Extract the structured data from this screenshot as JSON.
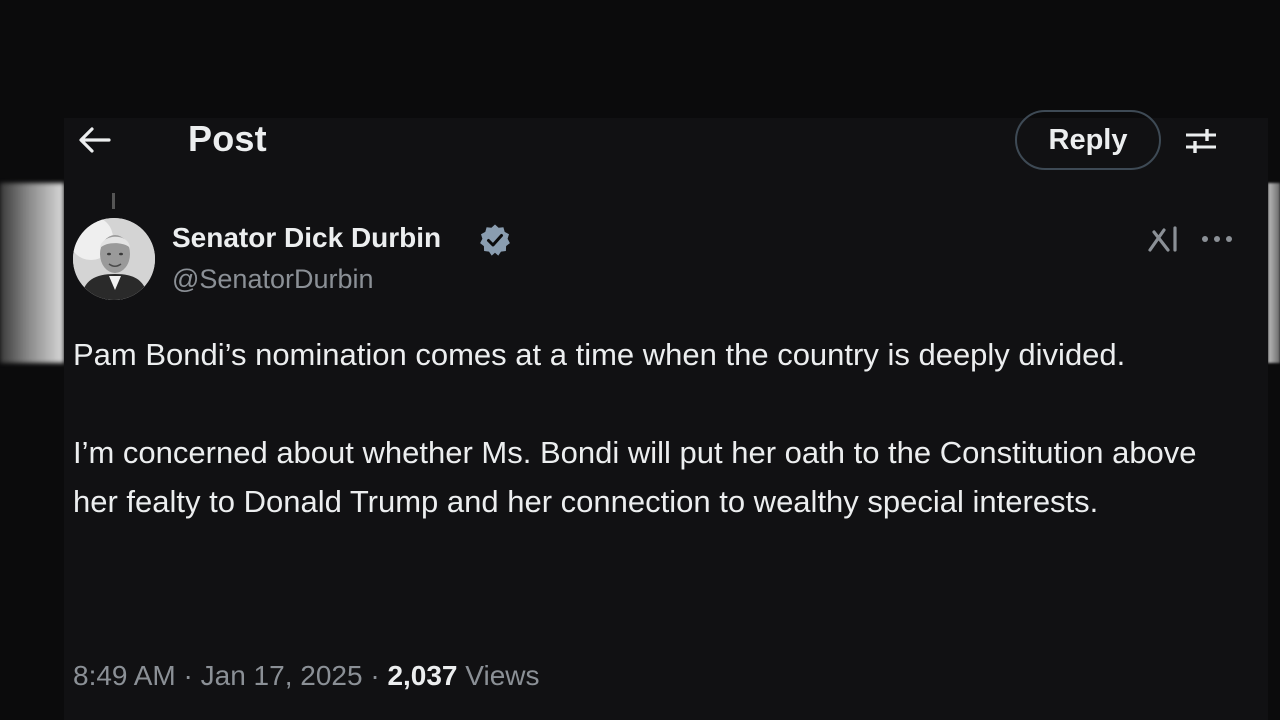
{
  "header": {
    "title": "Post",
    "reply_label": "Reply",
    "back_icon": "arrow-left-icon",
    "filter_icon": "sliders-icon"
  },
  "tweet": {
    "author_name": "Senator Dick Durbin",
    "handle": "@SenatorDurbin",
    "verified": true,
    "paragraphs": [
      "Pam Bondi’s nomination comes at a time when the country is deeply divided.",
      "I’m concerned about whether Ms. Bondi will put her oath to the Constitution above her fealty to Donald Trump and her connection to wealthy special interests."
    ],
    "time": "8:49 AM",
    "date": "Jan 17, 2025",
    "separator": " · ",
    "views_count": "2,037",
    "views_label": "Views"
  },
  "colors": {
    "background": "#0b0b0c",
    "text": "#eceeef",
    "secondary_text": "#8b9096",
    "verified_blue": "#8a9db0",
    "reply_border": "#3e4a55"
  }
}
